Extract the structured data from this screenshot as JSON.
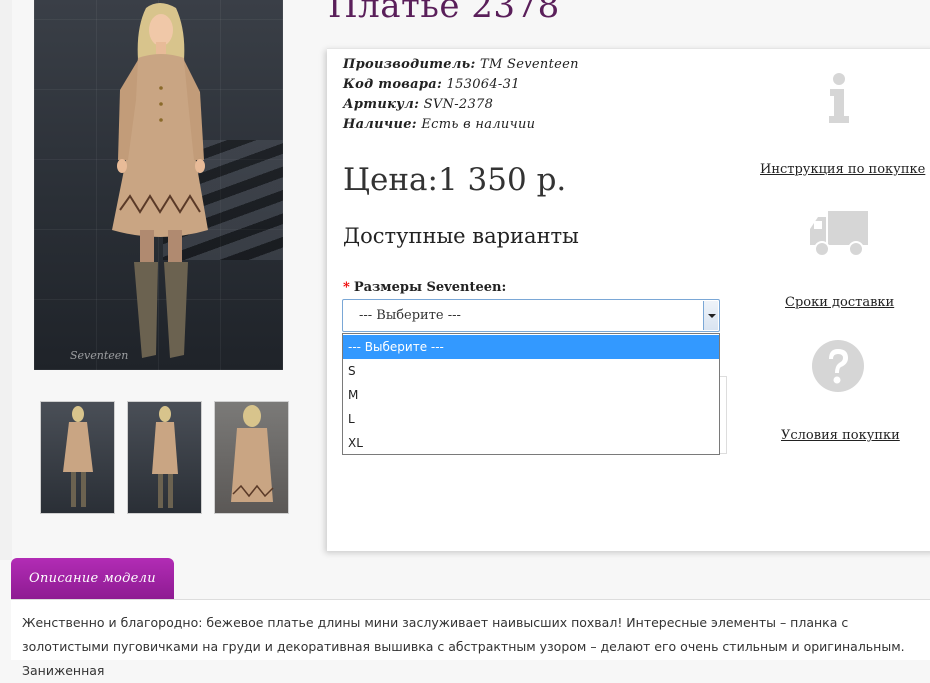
{
  "product": {
    "title": "Платье 2378",
    "price": "Цена:1 350 р."
  },
  "specs": [
    {
      "label": "Производитель:",
      "value": "TM Seventeen"
    },
    {
      "label": "Код товара:",
      "value": "153064-31"
    },
    {
      "label": "Артикул:",
      "value": "SVN-2378"
    },
    {
      "label": "Наличие:",
      "value": "Есть в наличии"
    }
  ],
  "variants": {
    "heading": "Доступные варианты",
    "size_label_required_mark": "*",
    "size_label": "Размеры Seventeen:",
    "selected_value": "--- Выберите ---",
    "options": [
      "--- Выберите ---",
      "S",
      "M",
      "L",
      "XL"
    ]
  },
  "side_links": {
    "instruction": "Инструкция по покупке",
    "delivery": "Сроки доставки",
    "conditions": "Условия покупки"
  },
  "description": {
    "tab_label": "Описание модели",
    "text": "Женственно и благородно: бежевое платье длины мини заслуживает наивысших похвал! Интересные элементы – планка с золотистыми пуговичками на груди и декоративная вышивка с абстрактным узором – делают его очень стильным и оригинальным. Заниженная"
  },
  "image": {
    "watermark": "Seventeen"
  },
  "colors": {
    "title": "#5a1f5a",
    "tab_gradient_top": "#b22cb5",
    "tab_gradient_bottom": "#8e1b92",
    "dropdown_highlight": "#3399ff"
  }
}
